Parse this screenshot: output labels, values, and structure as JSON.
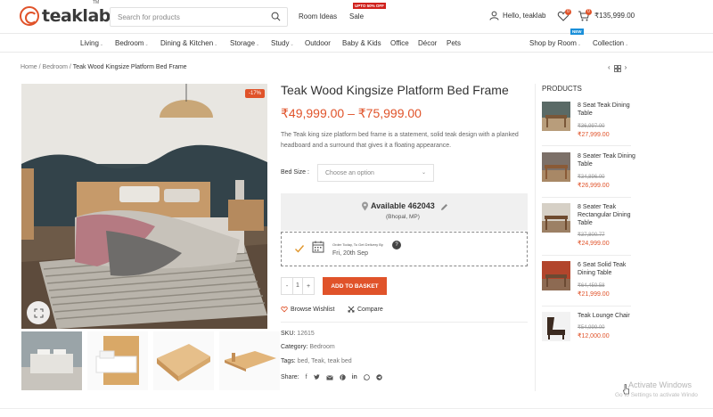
{
  "header": {
    "logo_text": "teaklab",
    "logo_tm": "TM",
    "search_placeholder": "Search for products",
    "room_ideas": "Room Ideas",
    "sale": "Sale",
    "sale_badge": "UPTO 50% OFF",
    "user_greeting": "Hello, teaklab",
    "wishlist_count": "0",
    "cart_count": "0",
    "cart_total": "₹135,999.00"
  },
  "categories": [
    {
      "label": "Living",
      "dropdown": true
    },
    {
      "label": "Bedroom",
      "dropdown": true
    },
    {
      "label": "Dining & Kitchen",
      "dropdown": true
    },
    {
      "label": "Storage",
      "dropdown": true
    },
    {
      "label": "Study",
      "dropdown": true
    },
    {
      "label": "Outdoor",
      "dropdown": false
    },
    {
      "label": "Baby & Kids",
      "dropdown": false
    },
    {
      "label": "Office",
      "dropdown": false
    },
    {
      "label": "Décor",
      "dropdown": false
    },
    {
      "label": "Pets",
      "dropdown": false
    },
    {
      "label": "Shop by Room",
      "dropdown": true
    },
    {
      "label": "Collection",
      "dropdown": true
    }
  ],
  "new_badge": "NEW",
  "breadcrumb": {
    "home": "Home",
    "sep": "/",
    "bedroom": "Bedroom",
    "current": "Teak Wood Kingsize Platform Bed Frame"
  },
  "product": {
    "title": "Teak Wood Kingsize Platform Bed Frame",
    "price_range": "₹49,999.00 – ₹75,999.00",
    "discount": "-17%",
    "description": "The Teak king size platform bed frame is a statement, solid teak design with a planked headboard and a surround that gives it a floating appearance.",
    "bed_size_label": "Bed Size :",
    "bed_size_placeholder": "Choose an option",
    "availability_title": "Available 462043",
    "availability_location": "(Bhopal, MP)",
    "delivery_small": "Order Today, To Get Delivery By",
    "delivery_date": "Fri, 20th Sep",
    "delivery_help": "?",
    "qty_minus": "-",
    "qty_value": "1",
    "qty_plus": "+",
    "add_to_basket": "ADD TO BASKET",
    "browse_wishlist": "Browse Wishlist",
    "compare": "Compare",
    "sku_label": "SKU:",
    "sku_value": "12615",
    "category_label": "Category:",
    "category_value": "Bedroom",
    "tags_label": "Tags:",
    "tags_value": "bed, Teak, teak bed",
    "share_label": "Share:"
  },
  "sidebar": {
    "title": "PRODUCTS",
    "items": [
      {
        "name": "8 Seat Teak Dining Table",
        "old": "₹36,997.00",
        "new": "₹27,999.00"
      },
      {
        "name": "8 Seater Teak Dining Table",
        "old": "₹34,896.00",
        "new": "₹26,999.00"
      },
      {
        "name": "8 Seater Teak Rectangular Dining Table",
        "old": "₹37,800.77",
        "new": "₹24,999.00"
      },
      {
        "name": "6 Seat Solid Teak Dining Table",
        "old": "₹64,459.58",
        "new": "₹21,999.00"
      },
      {
        "name": "Teak Lounge Chair",
        "old": "₹54,999.00",
        "new": "₹12,000.00"
      }
    ]
  },
  "os_watermark": {
    "title": "Activate Windows",
    "sub": "Go to Settings to activate Windo"
  },
  "colors": {
    "accent": "#e0532a",
    "sale_badge": "#d0211c",
    "new_badge": "#1a8fd9"
  }
}
